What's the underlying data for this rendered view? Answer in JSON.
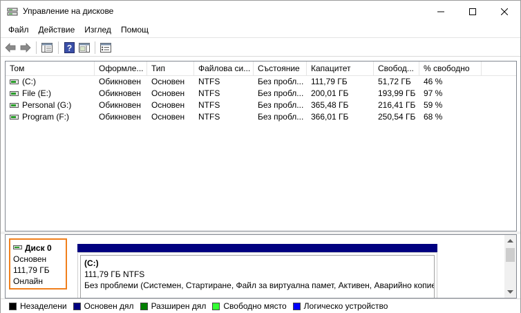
{
  "window": {
    "title": "Управление на дискове"
  },
  "menu": {
    "items": [
      "Файл",
      "Действие",
      "Изглед",
      "Помощ"
    ]
  },
  "volumes": {
    "columns": [
      "Том",
      "Оформле...",
      "Тип",
      "Файлова си...",
      "Състояние",
      "Капацитет",
      "Свобод...",
      "% свободно"
    ],
    "rows": [
      [
        "(C:)",
        "Обикновен",
        "Основен",
        "NTFS",
        "Без пробл...",
        "111,79 ГБ",
        "51,72 ГБ",
        "46 %"
      ],
      [
        "File (E:)",
        "Обикновен",
        "Основен",
        "NTFS",
        "Без пробл...",
        "200,01 ГБ",
        "193,99 ГБ",
        "97 %"
      ],
      [
        "Personal (G:)",
        "Обикновен",
        "Основен",
        "NTFS",
        "Без пробл...",
        "365,48 ГБ",
        "216,41 ГБ",
        "59 %"
      ],
      [
        "Program (F:)",
        "Обикновен",
        "Основен",
        "NTFS",
        "Без пробл...",
        "366,01 ГБ",
        "250,54 ГБ",
        "68 %"
      ]
    ]
  },
  "disk": {
    "name": "Диск 0",
    "type": "Основен",
    "size": "111,79 ГБ",
    "status": "Онлайн",
    "partition": {
      "name": "(C:)",
      "size_fs": "111,79 ГБ NTFS",
      "status": "Без проблеми (Системен, Стартиране, Файл за виртуална памет, Активен, Аварийно копие"
    }
  },
  "legend": [
    {
      "label": "Незаделени",
      "color": "#000000"
    },
    {
      "label": "Основен дял",
      "color": "#000080"
    },
    {
      "label": "Разширен дял",
      "color": "#008000"
    },
    {
      "label": "Свободно място",
      "color": "#33ff33"
    },
    {
      "label": "Логическо устройство",
      "color": "#0000ff"
    }
  ],
  "colors": {
    "disk_selection": "#f07f1b",
    "primary_partition": "#000080"
  }
}
